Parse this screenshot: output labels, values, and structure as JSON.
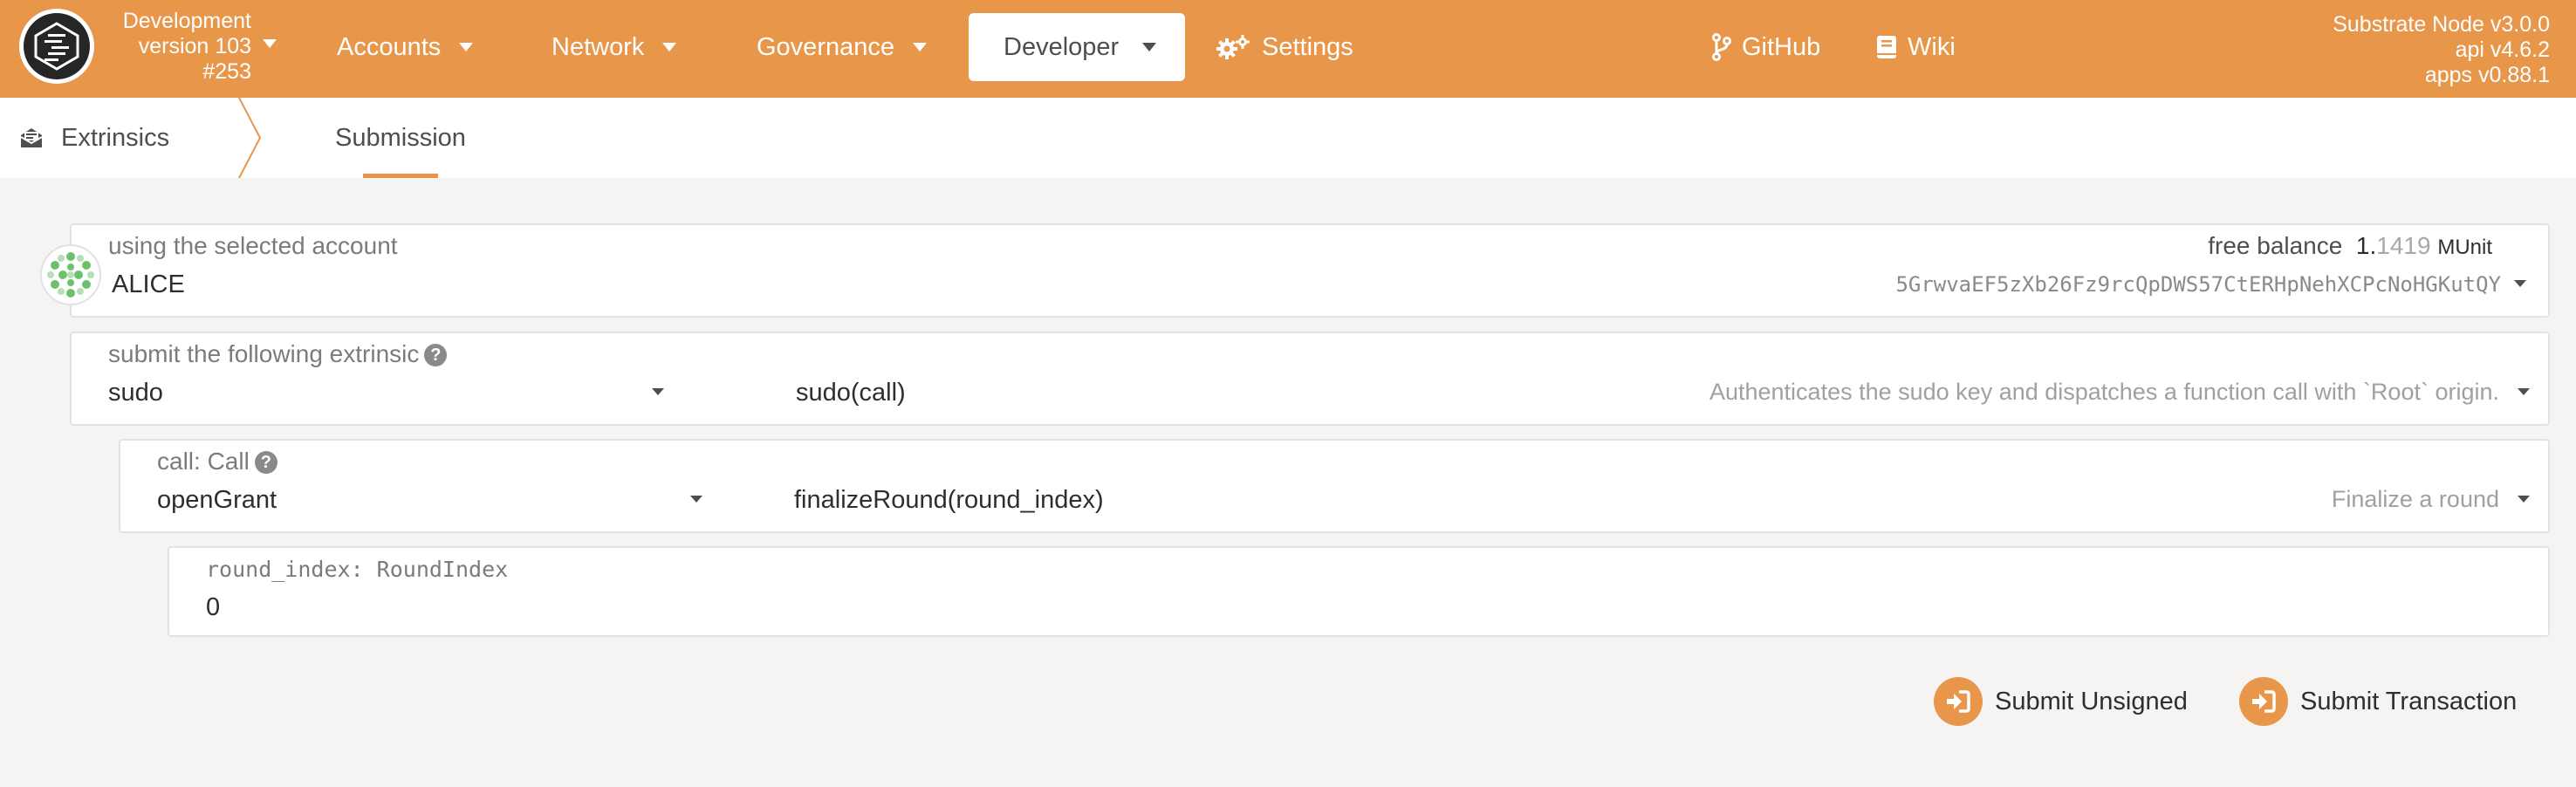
{
  "header": {
    "chain": {
      "name": "Development",
      "version": "version 103",
      "block": "#253"
    },
    "nav": {
      "accounts": "Accounts",
      "network": "Network",
      "governance": "Governance",
      "developer": "Developer",
      "settings": "Settings",
      "github": "GitHub",
      "wiki": "Wiki"
    },
    "versions": {
      "node": "Substrate Node v3.0.0",
      "api": "api v4.6.2",
      "apps": "apps v0.88.1"
    }
  },
  "subnav": {
    "section": "Extrinsics",
    "tab": "Submission"
  },
  "account": {
    "label": "using the selected account",
    "name": "ALICE",
    "balance_label": "free balance",
    "balance_int": "1.",
    "balance_frac": "1419",
    "balance_unit": "MUnit",
    "address": "5GrwvaEF5zXb26Fz9rcQpDWS57CtERHpNehXCPcNoHGKutQY"
  },
  "extrinsic": {
    "label": "submit the following extrinsic",
    "module": "sudo",
    "method": "sudo(call)",
    "description": "Authenticates the sudo key and dispatches a function call with `Root` origin."
  },
  "call": {
    "label": "call: Call",
    "module": "openGrant",
    "method": "finalizeRound(round_index)",
    "description": "Finalize a round"
  },
  "param": {
    "label": "round_index: RoundIndex",
    "value": "0"
  },
  "actions": {
    "submit_unsigned": "Submit Unsigned",
    "submit_transaction": "Submit Transaction"
  },
  "colors": {
    "accent": "#e7964a",
    "identicon_green": "#6cc26c"
  },
  "icons": {
    "logo": "substrate-logo",
    "settings": "gears-icon",
    "github": "code-branch-icon",
    "wiki": "book-icon",
    "extrinsics": "envelope-open-icon",
    "submit": "sign-in-icon"
  }
}
